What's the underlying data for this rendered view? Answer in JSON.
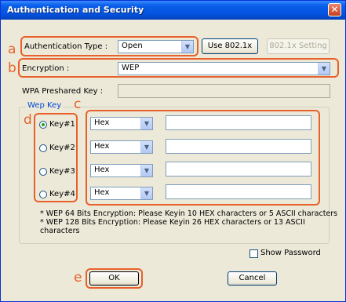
{
  "window": {
    "title": "Authentication and Security",
    "close_glyph": "✕"
  },
  "auth": {
    "label": "Authentication Type :",
    "value": "Open",
    "use8021x_label": "Use 802.1x",
    "setting8021x_label": "802.1x Setting"
  },
  "encryption": {
    "label": "Encryption :",
    "value": "WEP"
  },
  "wpa": {
    "label": "WPA Preshared Key :",
    "value": ""
  },
  "wepkey": {
    "group_label": "Wep Key",
    "keys": [
      {
        "label": "Key#1",
        "selected": true,
        "format": "Hex",
        "value": ""
      },
      {
        "label": "Key#2",
        "selected": false,
        "format": "Hex",
        "value": ""
      },
      {
        "label": "Key#3",
        "selected": false,
        "format": "Hex",
        "value": ""
      },
      {
        "label": "Key#4",
        "selected": false,
        "format": "Hex",
        "value": ""
      }
    ]
  },
  "notes": {
    "line1": "* WEP 64 Bits Encryption:  Please Keyin 10 HEX characters or 5 ASCII characters",
    "line2": "* WEP 128 Bits Encryption:  Please Keyin 26 HEX characters or 13 ASCII",
    "line3": "characters"
  },
  "show_password": {
    "label": "Show Password",
    "checked": false
  },
  "buttons": {
    "ok": "OK",
    "cancel": "Cancel"
  },
  "annotations": {
    "a": "a",
    "b": "b",
    "c": "c",
    "d": "d",
    "e": "e"
  },
  "colors": {
    "annotation": "#e8612c",
    "title_bar": "#0454e0",
    "dialog_bg": "#ece9d8"
  }
}
